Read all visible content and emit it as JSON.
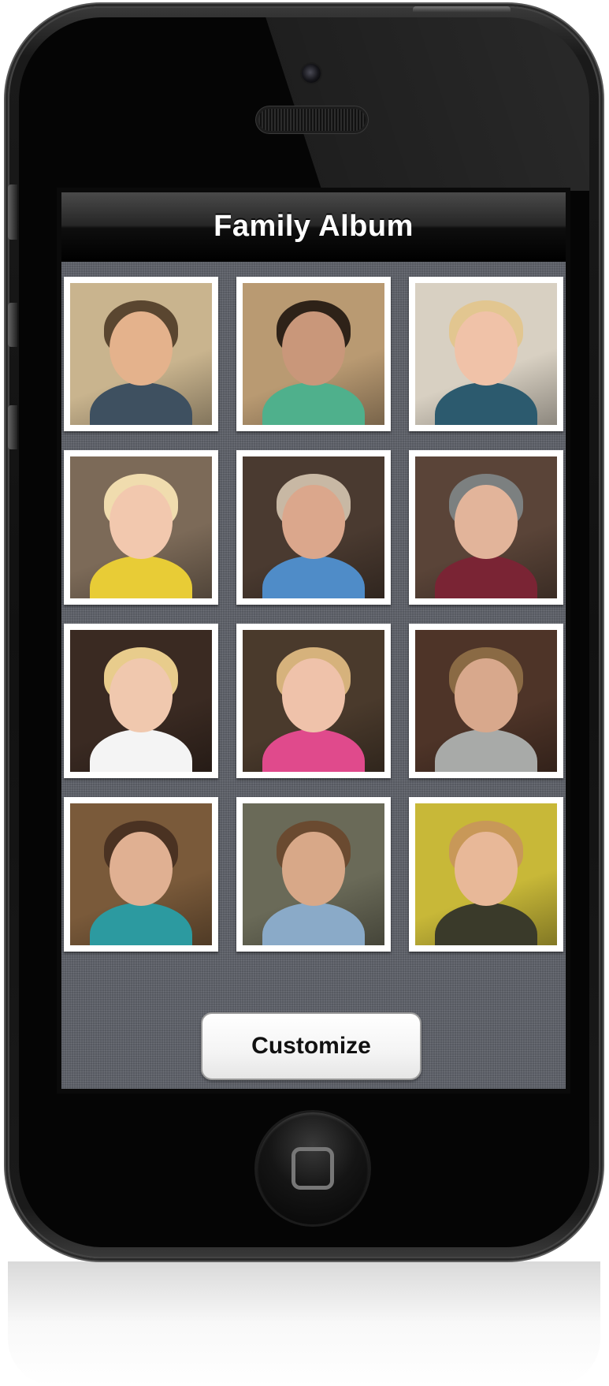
{
  "navbar": {
    "title": "Family Album"
  },
  "photos": [
    {
      "bg": "#c9b48e",
      "skin": "#e4b28c",
      "hair": "#5a4630",
      "shirt": "#3e5060"
    },
    {
      "bg": "#b99a72",
      "skin": "#c9977a",
      "hair": "#2e2218",
      "shirt": "#4fb08c"
    },
    {
      "bg": "#d8d0c2",
      "skin": "#f0c2a8",
      "hair": "#e2c690",
      "shirt": "#2c5a6e"
    },
    {
      "bg": "#7c6a58",
      "skin": "#f2c8ae",
      "hair": "#f0dcae",
      "shirt": "#e8cc36"
    },
    {
      "bg": "#4a3a30",
      "skin": "#dba78c",
      "hair": "#c8b8a4",
      "shirt": "#4f8cc8"
    },
    {
      "bg": "#5a4438",
      "skin": "#e2b49a",
      "hair": "#7c8080",
      "shirt": "#7a2434"
    },
    {
      "bg": "#3a2a22",
      "skin": "#f0c8ae",
      "hair": "#e8cc8c",
      "shirt": "#f4f4f4"
    },
    {
      "bg": "#4a3a2c",
      "skin": "#efc2aa",
      "hair": "#d6b27c",
      "shirt": "#e04a8c"
    },
    {
      "bg": "#4e3428",
      "skin": "#d8a88c",
      "hair": "#8a6a44",
      "shirt": "#a8aaa8"
    },
    {
      "bg": "#7a5a3a",
      "skin": "#e0b092",
      "hair": "#4a3222",
      "shirt": "#2c9aa0"
    },
    {
      "bg": "#6a6a58",
      "skin": "#d8a888",
      "hair": "#6a4a30",
      "shirt": "#8aaac8"
    },
    {
      "bg": "#c8b838",
      "skin": "#e8b898",
      "hair": "#c89858",
      "shirt": "#3a3a2a"
    }
  ],
  "customize_button": {
    "label": "Customize"
  }
}
